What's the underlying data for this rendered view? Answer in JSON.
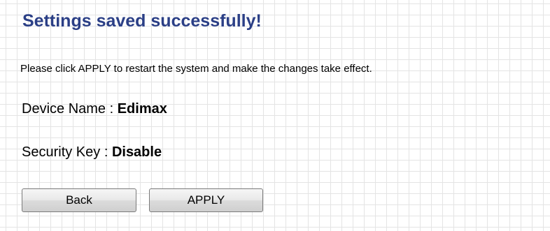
{
  "page": {
    "title": "Settings saved successfully!",
    "notice": "Please click APPLY to restart the system and make the changes take effect."
  },
  "info": {
    "device_name_label": "Device Name : ",
    "device_name_value": "Edimax",
    "security_key_label": "Security Key : ",
    "security_key_value": "Disable"
  },
  "buttons": {
    "back_label": "Back",
    "apply_label": "APPLY"
  },
  "colors": {
    "title": "#2b3f86",
    "grid_lines": "#e4e4e4",
    "background": "#ffffff"
  }
}
